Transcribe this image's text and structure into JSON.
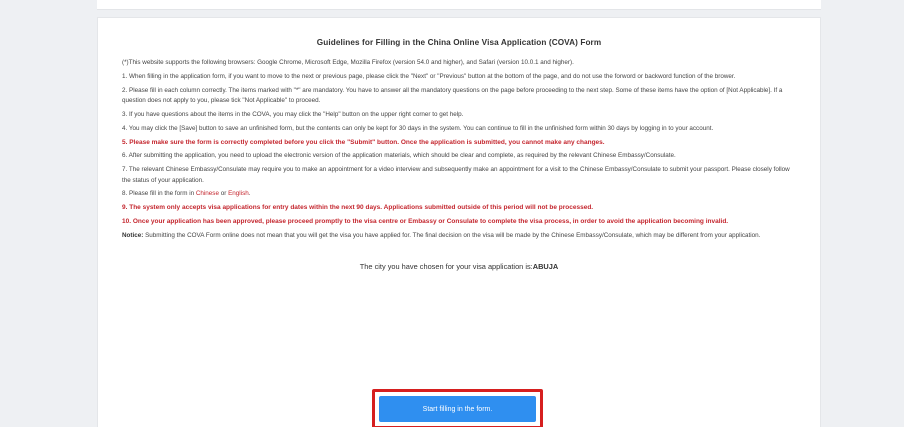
{
  "guidelines": {
    "title": "Guidelines for Filling in the China Online Visa Application (COVA) Form",
    "p0": "(*)This website supports the following browsers: Google Chrome, Microsoft Edge, Mozilla Firefox (version 54.0 and higher), and Safari (version 10.0.1 and higher).",
    "p1": "1. When filling in the application form, if you want to move to the next or previous page, please click the \"Next\" or \"Previous\" button at the bottom of the page, and do not use the forword or backword function of the brower.",
    "p2": "2. Please fill in each column correctly. The items marked with \"*\" are mandatory. You have to answer all the mandatory questions on the page before proceeding to the next step. Some of these items have the option of [Not Applicable]. If a question does not apply to you, please tick \"Not Applicable\" to proceed.",
    "p3": "3. If you have questions about the items in the COVA, you may click the \"Help\" button on the upper right corner to get help.",
    "p4": "4. You may click the [Save] button to save an unfinished form, but the contents can only be kept for 30 days in the system. You can continue to fill in the unfinished form within 30 days by logging in to your account.",
    "p5": "5. Please make sure the form is correctly completed before you click the \"Submit\" button. Once the application is submitted, you cannot make any changes.",
    "p6": "6. After submitting the application, you need to upload the electronic version of the application materials, which should be clear and complete, as required by the relevant Chinese Embassy/Consulate.",
    "p7": "7. The relevant Chinese Embassy/Consulate may require you to make an appointment for a video interview and subsequently make an appointment for a visit to the Chinese Embassy/Consulate to submit your passport. Please closely follow the status of your application.",
    "p8_prefix": "8. Please fill in the form in ",
    "p8_chinese": "Chinese",
    "p8_or": " or ",
    "p8_english": "English",
    "p8_suffix": ".",
    "p9": "9. The system only accepts visa applications for entry dates within the next 90 days. Applications submitted outside of this period will not be processed.",
    "p10": "10. Once your application has been approved, please proceed promptly to the visa centre or Embassy or Consulate to complete the visa process, in order to avoid the application becoming invalid.",
    "notice_label": "Notice:",
    "notice_text": " Submitting the COVA Form online does not mean that you will get the visa you have applied for. The final decision on the visa will be made by the Chinese Embassy/Consulate, which may be different from your application."
  },
  "city": {
    "prefix": "The city you have chosen for your visa application is:",
    "name": "ABUJA"
  },
  "start_button": {
    "label": "Start filling in the form."
  },
  "colors": {
    "accent_blue": "#2f8ff0",
    "warning_red": "#c4262e",
    "highlight_border": "#d61f1f"
  }
}
